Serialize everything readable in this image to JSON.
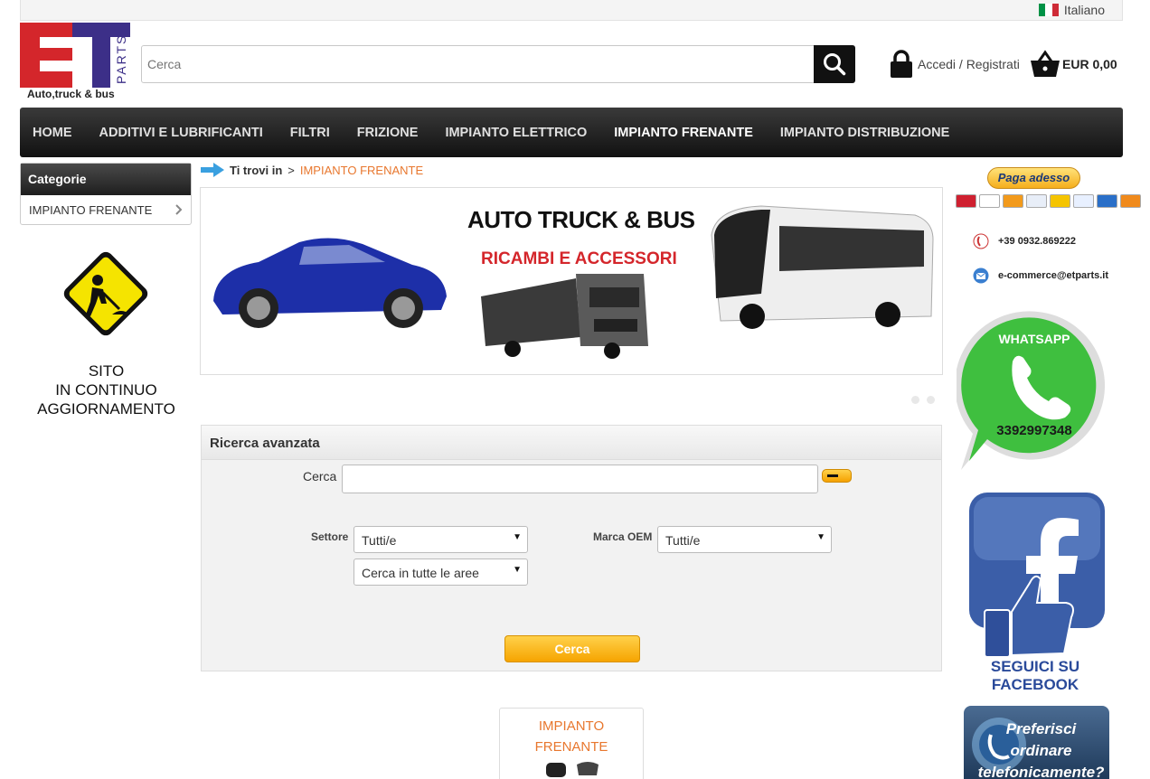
{
  "topbar": {
    "language": "Italiano"
  },
  "logo": {
    "tagline": "Auto,truck & bus",
    "letters": "ET",
    "parts": "PARTS"
  },
  "search": {
    "placeholder": "Cerca"
  },
  "account": {
    "login_label": "Accedi / Registrati"
  },
  "cart": {
    "total": "EUR 0,00"
  },
  "nav": {
    "items": [
      {
        "label": "HOME"
      },
      {
        "label": "ADDITIVI E LUBRIFICANTI"
      },
      {
        "label": "FILTRI"
      },
      {
        "label": "FRIZIONE"
      },
      {
        "label": "IMPIANTO ELETTRICO"
      },
      {
        "label": "IMPIANTO FRENANTE"
      },
      {
        "label": "IMPIANTO DISTRIBUZIONE"
      }
    ],
    "active_index": 5
  },
  "sidebar": {
    "header": "Categorie",
    "items": [
      {
        "label": "IMPIANTO FRENANTE"
      }
    ],
    "construction_text": [
      "SITO",
      "IN CONTINUO",
      "AGGIORNAMENTO"
    ]
  },
  "breadcrumb": {
    "prefix": "Ti trovi in",
    "separator": ">",
    "current": "IMPIANTO FRENANTE"
  },
  "banner": {
    "title": "AUTO TRUCK & BUS",
    "subtitle": "RICAMBI E ACCESSORI"
  },
  "advanced_search": {
    "title": "Ricerca avanzata",
    "search_label": "Cerca",
    "sector_label": "Settore",
    "sector_value": "Tutti/e",
    "area_value": "Cerca in tutte le aree",
    "brand_label": "Marca OEM",
    "brand_value": "Tutti/e",
    "submit_label": "Cerca"
  },
  "category_tile": {
    "label": "IMPIANTO FRENANTE"
  },
  "right": {
    "paypal_label": "Paga adesso",
    "phone": "+39 0932.869222",
    "email": "e-commerce@etparts.it",
    "whatsapp_title": "WHATSAPP",
    "whatsapp_number": "3392997348",
    "facebook_text": [
      "SEGUICI SU",
      "FACEBOOK"
    ],
    "phone_promo_text": [
      "Preferisci",
      "ordinare",
      "telefonicamente?"
    ]
  },
  "colors": {
    "accent": "#e8772e",
    "nav_bg": "#1e1e1e",
    "button_yellow": "#f6a400",
    "logo_red": "#d4262b",
    "logo_blue": "#3c2f88"
  }
}
